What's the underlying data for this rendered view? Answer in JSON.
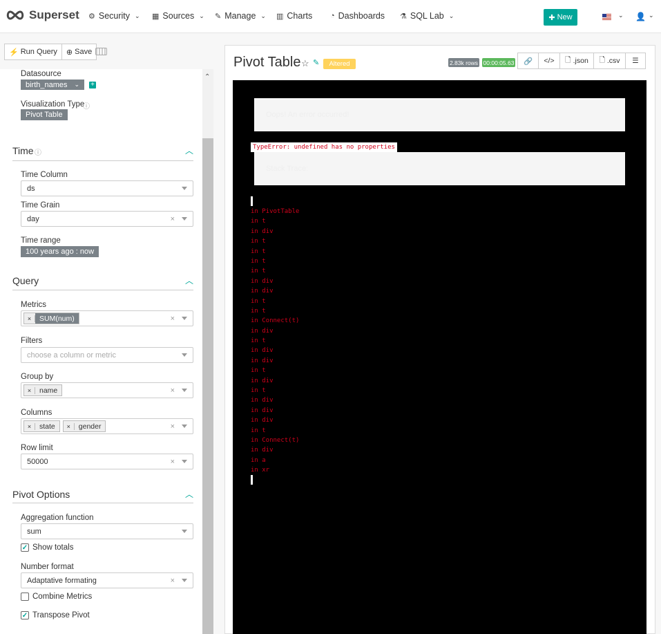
{
  "navbar": {
    "brand": "Superset",
    "items": [
      {
        "label": "Security",
        "icon": "cogs-icon"
      },
      {
        "label": "Sources",
        "icon": "table-icon"
      },
      {
        "label": "Manage",
        "icon": "wrench-icon"
      },
      {
        "label": "Charts",
        "icon": "bar-chart-icon"
      },
      {
        "label": "Dashboards",
        "icon": "dashboard-icon"
      },
      {
        "label": "SQL Lab",
        "icon": "flask-icon"
      }
    ],
    "new_label": "New"
  },
  "toolbar": {
    "run_label": "Run Query",
    "save_label": "Save"
  },
  "controls": {
    "datasource_label": "Datasource",
    "datasource_value": "birth_names",
    "viz_type_label": "Visualization Type",
    "viz_type_value": "Pivot Table",
    "time": {
      "title": "Time",
      "time_column_label": "Time Column",
      "time_column_value": "ds",
      "time_grain_label": "Time Grain",
      "time_grain_value": "day",
      "time_range_label": "Time range",
      "time_range_value": "100 years ago : now"
    },
    "query": {
      "title": "Query",
      "metrics_label": "Metrics",
      "metrics": [
        "SUM(num)"
      ],
      "filters_label": "Filters",
      "filters_placeholder": "choose a column or metric",
      "groupby_label": "Group by",
      "groupby": [
        "name"
      ],
      "columns_label": "Columns",
      "columns": [
        "state",
        "gender"
      ],
      "row_limit_label": "Row limit",
      "row_limit_value": "50000"
    },
    "pivot": {
      "title": "Pivot Options",
      "agg_label": "Aggregation function",
      "agg_value": "sum",
      "show_totals_label": "Show totals",
      "show_totals": true,
      "number_format_label": "Number format",
      "number_format_value": "Adaptative formating",
      "combine_metrics_label": "Combine Metrics",
      "combine_metrics": false,
      "transpose_label": "Transpose Pivot",
      "transpose": true
    }
  },
  "chart": {
    "title": "Pivot Table",
    "altered_label": "Altered",
    "rows_badge": "2.83k rows",
    "time_badge": "00:00:05.63",
    "json_label": ".json",
    "csv_label": ".csv",
    "error_title": "Oops! An error occurred!",
    "error_message": "TypeError: undefined has no properties",
    "stack_trace_label": "Stack Trace:",
    "stack": [
      "in PivotTable",
      "in t",
      "in div",
      "in t",
      "in t",
      "in t",
      "in t",
      "in div",
      "in div",
      "in t",
      "in t",
      "in Connect(t)",
      "in div",
      "in t",
      "in div",
      "in div",
      "in t",
      "in div",
      "in t",
      "in div",
      "in div",
      "in div",
      "in t",
      "in Connect(t)",
      "in div",
      "in a",
      "in xr"
    ],
    "highlighted_index": 12
  },
  "colors": {
    "accent": "#00a699",
    "altered": "#ffd35c",
    "rows_badge": "#7a8288",
    "time_badge": "#5cb85c",
    "error": "#d0021b"
  }
}
